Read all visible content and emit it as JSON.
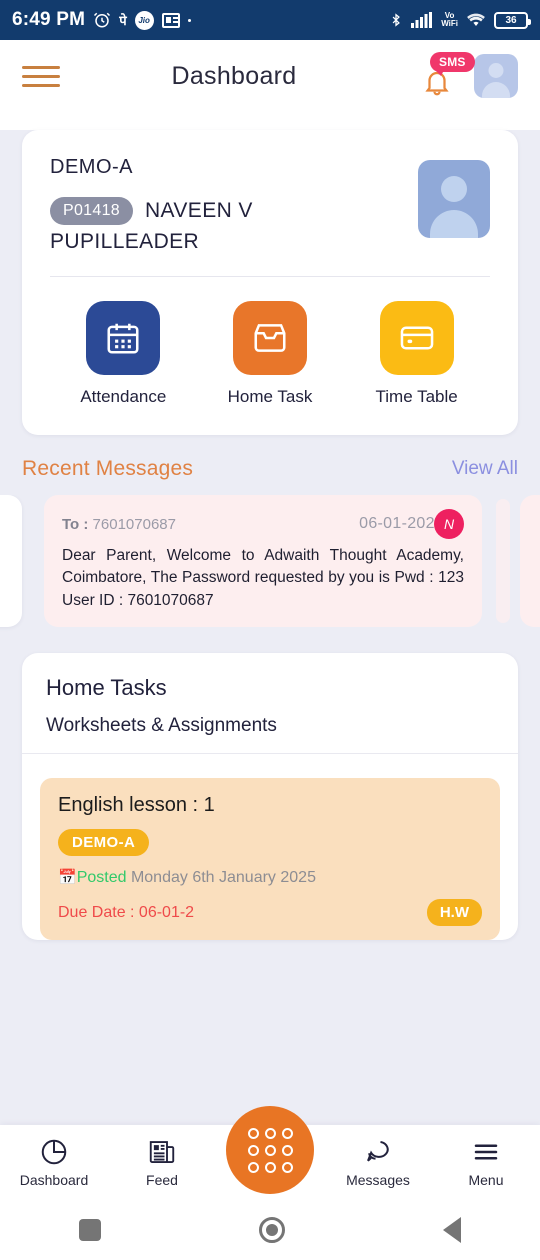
{
  "status_bar": {
    "time": "6:49 PM",
    "battery_level": "36",
    "network_label": "VoWiFi",
    "icons": [
      "alarm-clock-icon",
      "phonepe-icon",
      "jio-icon",
      "news-icon",
      "dot-icon",
      "bluetooth-icon",
      "signal-bars-icon",
      "vowifi-icon",
      "wifi-icon",
      "battery-icon"
    ],
    "jio_label": "Jio",
    "phonepe_label": "पे"
  },
  "header": {
    "title": "Dashboard",
    "sms_badge": "SMS",
    "menu_icon": "hamburger-icon",
    "bell_icon": "notification-bell-icon",
    "avatar_icon": "profile-avatar-icon"
  },
  "profile": {
    "class_name": "DEMO-A",
    "student_id": "P01418",
    "student_name": "NAVEEN V",
    "role": "PUPILLEADER",
    "photo_icon": "student-photo-placeholder"
  },
  "quick_actions": [
    {
      "label": "Attendance",
      "icon": "calendar-icon",
      "color": "#2c4a96"
    },
    {
      "label": "Home Task",
      "icon": "inbox-tray-icon",
      "color": "#e8762a"
    },
    {
      "label": "Time Table",
      "icon": "card-icon",
      "color": "#fbbb14"
    }
  ],
  "recent_messages": {
    "title": "Recent Messages",
    "view_all": "View All",
    "message": {
      "to_label": "To :",
      "to_number": "7601070687",
      "date": "06-01-2025",
      "avatar_initial": "N",
      "body": "Dear Parent, Welcome to Adwaith Thought Academy, Coimbatore, The Password requested by you is Pwd : 123 User ID : 7601070687"
    }
  },
  "home_tasks": {
    "title": "Home Tasks",
    "subtitle": "Worksheets & Assignments",
    "tasks": [
      {
        "title": "English lesson : 1",
        "class_chip": "DEMO-A",
        "posted_label": "Posted",
        "posted_date": "Monday 6th January 2025",
        "due_text": "Due Date : 06-01-2",
        "type_chip": "H.W",
        "calendar_icon": "calendar-small-icon"
      }
    ]
  },
  "bottom_nav": {
    "items": [
      {
        "label": "Dashboard",
        "icon": "pie-chart-icon"
      },
      {
        "label": "Feed",
        "icon": "newspaper-icon"
      },
      {
        "label": "Messages",
        "icon": "chat-bubble-icon"
      },
      {
        "label": "Menu",
        "icon": "hamburger-icon"
      }
    ],
    "fab_icon": "grid-apps-icon"
  },
  "android_nav": {
    "recents_icon": "square-recents-icon",
    "home_icon": "circle-home-icon",
    "back_icon": "triangle-back-icon"
  }
}
